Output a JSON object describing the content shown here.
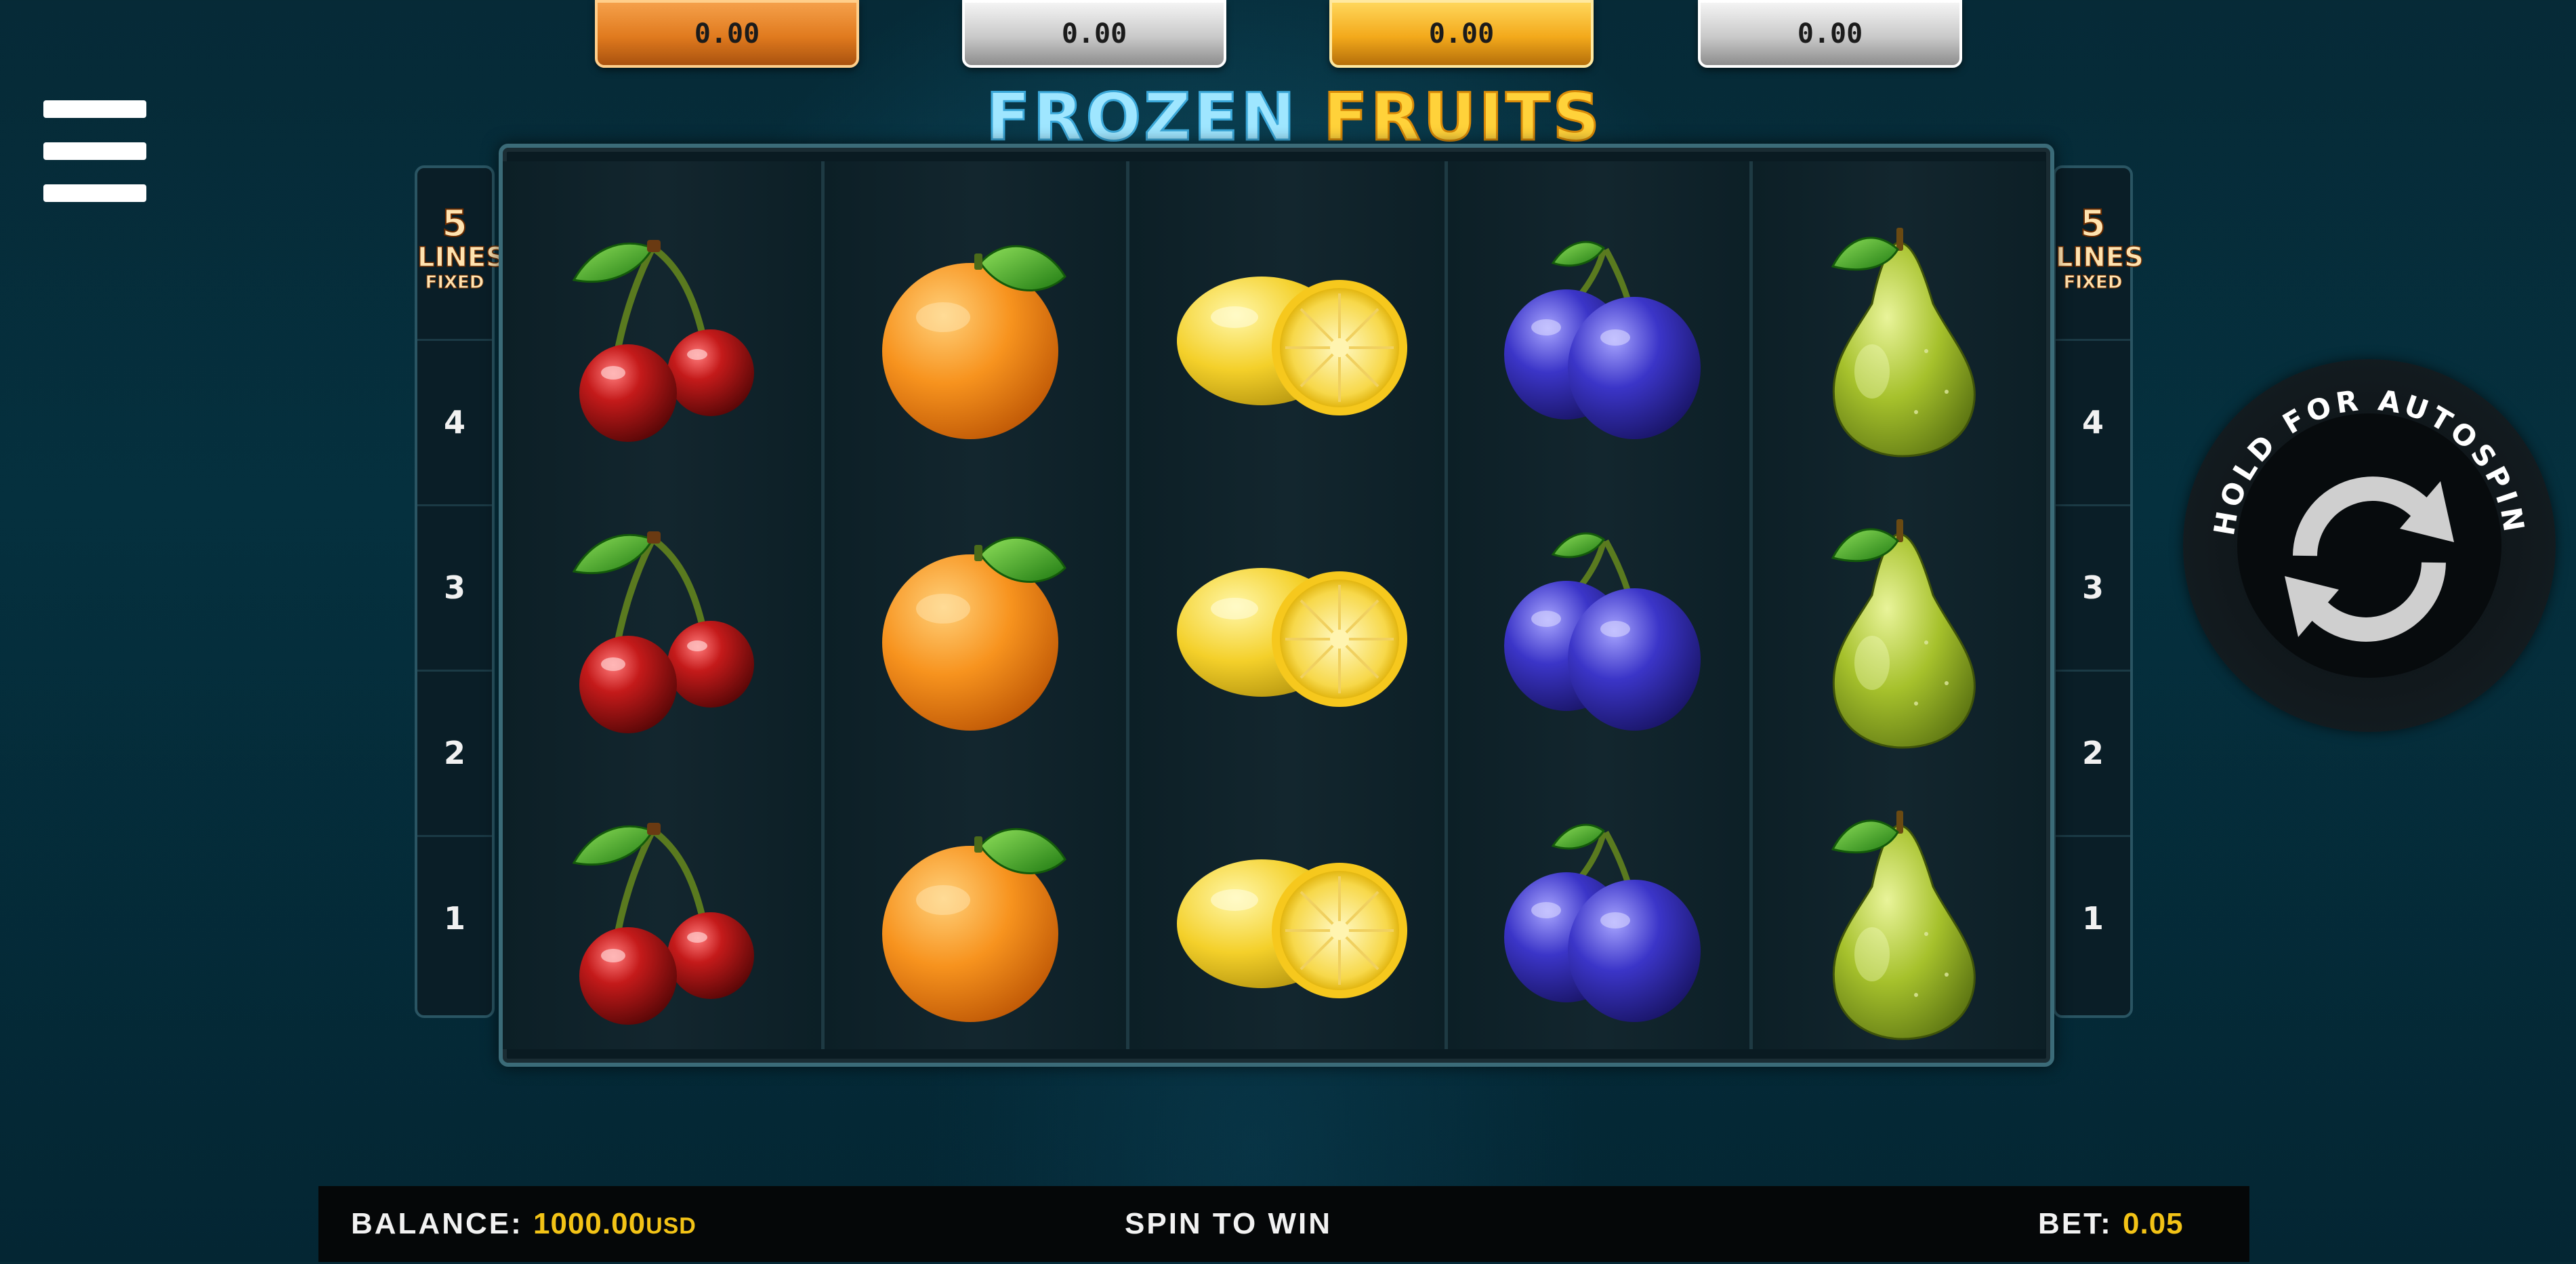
{
  "jackpots": [
    {
      "value": "0.00",
      "style": "orange"
    },
    {
      "value": "0.00",
      "style": "silver"
    },
    {
      "value": "0.00",
      "style": "gold"
    },
    {
      "value": "0.00",
      "style": "silver"
    }
  ],
  "menu": {
    "icon": "hamburger-menu-icon"
  },
  "logo": {
    "word1": "FROZEN",
    "word2": "FRUITS"
  },
  "lines_panel": {
    "count": "5",
    "label": "LINES",
    "fixed": "FIXED",
    "numbers": [
      "4",
      "3",
      "2",
      "1"
    ]
  },
  "reels": [
    [
      "cherry",
      "cherry",
      "cherry"
    ],
    [
      "orange",
      "orange",
      "orange"
    ],
    [
      "lemon",
      "lemon",
      "lemon"
    ],
    [
      "plum",
      "plum",
      "plum"
    ],
    [
      "pear",
      "pear",
      "pear"
    ]
  ],
  "autospin": {
    "label": "HOLD FOR AUTOSPIN",
    "icon": "refresh-spin-icon"
  },
  "status": {
    "balance_label": "BALANCE:",
    "balance_value": "1000.00",
    "balance_currency": "USD",
    "message": "SPIN TO WIN",
    "bet_label": "BET:",
    "bet_value": "0.05"
  },
  "colors": {
    "background": "#05303e",
    "accent_gold": "#f3c316",
    "jackpot_orange": "#e07a1e",
    "jackpot_silver": "#c9c9c9",
    "jackpot_gold": "#f3a91b"
  }
}
